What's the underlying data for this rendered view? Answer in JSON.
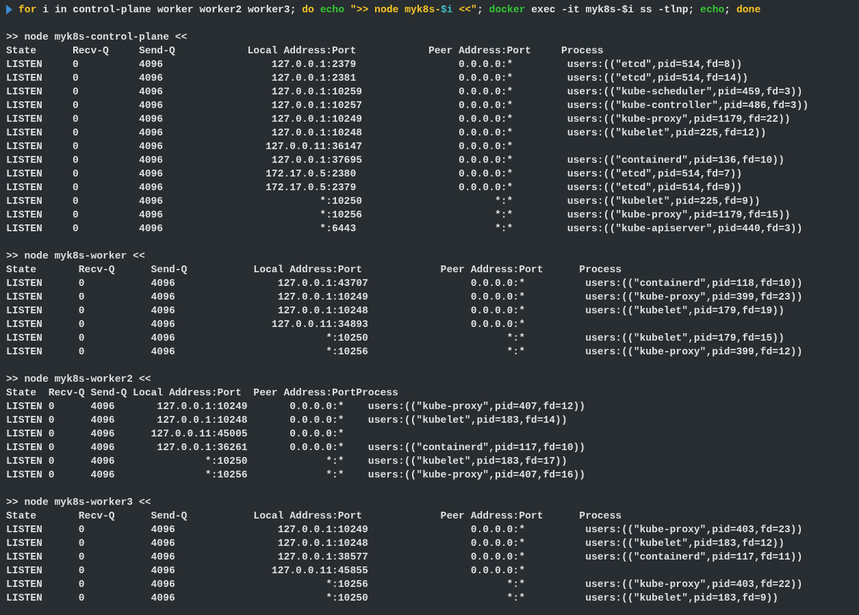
{
  "command": {
    "segments": [
      {
        "text": "for",
        "kind": "keyword"
      },
      {
        "text": " i in control-plane worker worker2 worker3; ",
        "kind": "plain"
      },
      {
        "text": "do ",
        "kind": "keyword"
      },
      {
        "text": "echo",
        "kind": "builtin"
      },
      {
        "text": " \">> node myk8s-",
        "kind": "string"
      },
      {
        "text": "$i",
        "kind": "variable"
      },
      {
        "text": " <<\"",
        "kind": "string"
      },
      {
        "text": "; ",
        "kind": "plain"
      },
      {
        "text": "docker",
        "kind": "builtin"
      },
      {
        "text": " exec -it myk8s-$i ss -tlnp; ",
        "kind": "plain"
      },
      {
        "text": "echo",
        "kind": "builtin"
      },
      {
        "text": "; ",
        "kind": "plain"
      },
      {
        "text": "done",
        "kind": "keyword"
      }
    ]
  },
  "sections": [
    {
      "title": ">> node myk8s-control-plane <<",
      "header": "State      Recv-Q     Send-Q            Local Address:Port            Peer Address:Port     Process",
      "rows": [
        "LISTEN     0          4096                  127.0.0.1:2379                 0.0.0.0:*         users:((\"etcd\",pid=514,fd=8))",
        "LISTEN     0          4096                  127.0.0.1:2381                 0.0.0.0:*         users:((\"etcd\",pid=514,fd=14))",
        "LISTEN     0          4096                  127.0.0.1:10259                0.0.0.0:*         users:((\"kube-scheduler\",pid=459,fd=3))",
        "LISTEN     0          4096                  127.0.0.1:10257                0.0.0.0:*         users:((\"kube-controller\",pid=486,fd=3))",
        "LISTEN     0          4096                  127.0.0.1:10249                0.0.0.0:*         users:((\"kube-proxy\",pid=1179,fd=22))",
        "LISTEN     0          4096                  127.0.0.1:10248                0.0.0.0:*         users:((\"kubelet\",pid=225,fd=12))",
        "LISTEN     0          4096                 127.0.0.11:36147                0.0.0.0:*",
        "LISTEN     0          4096                  127.0.0.1:37695                0.0.0.0:*         users:((\"containerd\",pid=136,fd=10))",
        "LISTEN     0          4096                 172.17.0.5:2380                 0.0.0.0:*         users:((\"etcd\",pid=514,fd=7))",
        "LISTEN     0          4096                 172.17.0.5:2379                 0.0.0.0:*         users:((\"etcd\",pid=514,fd=9))",
        "LISTEN     0          4096                          *:10250                      *:*         users:((\"kubelet\",pid=225,fd=9))",
        "LISTEN     0          4096                          *:10256                      *:*         users:((\"kube-proxy\",pid=1179,fd=15))",
        "LISTEN     0          4096                          *:6443                       *:*         users:((\"kube-apiserver\",pid=440,fd=3))"
      ]
    },
    {
      "title": ">> node myk8s-worker <<",
      "header": "State       Recv-Q      Send-Q           Local Address:Port             Peer Address:Port      Process",
      "rows": [
        "LISTEN      0           4096                 127.0.0.1:43707                 0.0.0.0:*          users:((\"containerd\",pid=118,fd=10))",
        "LISTEN      0           4096                 127.0.0.1:10249                 0.0.0.0:*          users:((\"kube-proxy\",pid=399,fd=23))",
        "LISTEN      0           4096                 127.0.0.1:10248                 0.0.0.0:*          users:((\"kubelet\",pid=179,fd=19))",
        "LISTEN      0           4096                127.0.0.11:34893                 0.0.0.0:*",
        "LISTEN      0           4096                         *:10250                       *:*          users:((\"kubelet\",pid=179,fd=15))",
        "LISTEN      0           4096                         *:10256                       *:*          users:((\"kube-proxy\",pid=399,fd=12))"
      ]
    },
    {
      "title": ">> node myk8s-worker2 <<",
      "header": "State  Recv-Q Send-Q Local Address:Port  Peer Address:PortProcess",
      "rows": [
        "LISTEN 0      4096       127.0.0.1:10249       0.0.0.0:*    users:((\"kube-proxy\",pid=407,fd=12))",
        "LISTEN 0      4096       127.0.0.1:10248       0.0.0.0:*    users:((\"kubelet\",pid=183,fd=14))",
        "LISTEN 0      4096      127.0.0.11:45005       0.0.0.0:*",
        "LISTEN 0      4096       127.0.0.1:36261       0.0.0.0:*    users:((\"containerd\",pid=117,fd=10))",
        "LISTEN 0      4096               *:10250             *:*    users:((\"kubelet\",pid=183,fd=17))",
        "LISTEN 0      4096               *:10256             *:*    users:((\"kube-proxy\",pid=407,fd=16))"
      ]
    },
    {
      "title": ">> node myk8s-worker3 <<",
      "header": "State       Recv-Q      Send-Q           Local Address:Port             Peer Address:Port      Process",
      "rows": [
        "LISTEN      0           4096                 127.0.0.1:10249                 0.0.0.0:*          users:((\"kube-proxy\",pid=403,fd=23))",
        "LISTEN      0           4096                 127.0.0.1:10248                 0.0.0.0:*          users:((\"kubelet\",pid=183,fd=12))",
        "LISTEN      0           4096                 127.0.0.1:38577                 0.0.0.0:*          users:((\"containerd\",pid=117,fd=11))",
        "LISTEN      0           4096                127.0.0.11:45855                 0.0.0.0:*",
        "LISTEN      0           4096                         *:10256                       *:*          users:((\"kube-proxy\",pid=403,fd=22))",
        "LISTEN      0           4096                         *:10250                       *:*          users:((\"kubelet\",pid=183,fd=9))"
      ]
    }
  ]
}
